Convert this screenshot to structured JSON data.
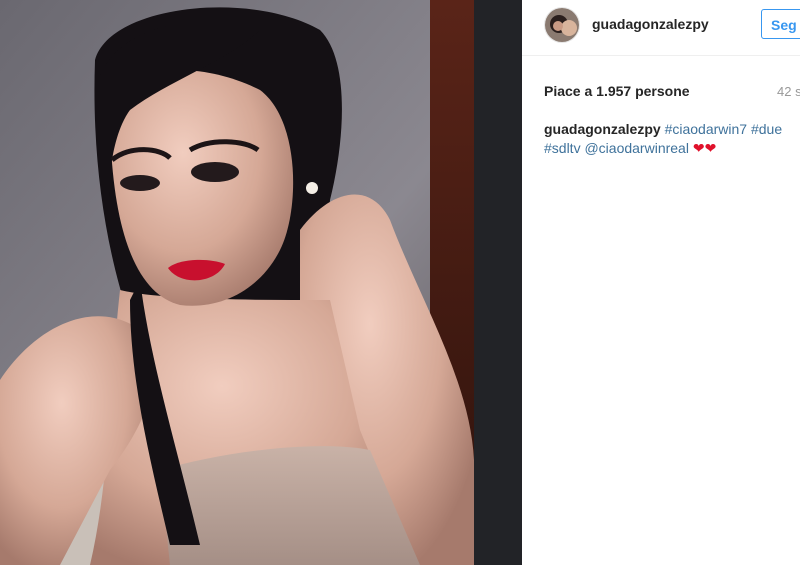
{
  "post": {
    "username": "guadagonzalezpy",
    "follow_label": "Seg",
    "likes_text": "Piace a 1.957 persone",
    "time_text": "42 s",
    "caption": {
      "username": "guadagonzalezpy",
      "tags_line1": [
        "#ciaodarwin7",
        "#due"
      ],
      "tags_line2": [
        "#sdltv",
        "@ciaodarwinreal"
      ],
      "emoji": "❤❤"
    }
  },
  "colors": {
    "link_blue": "#3897f0",
    "tag_blue": "#3f729b",
    "heart_red": "#e0112b"
  },
  "icons": [
    "avatar",
    "heart-icon"
  ]
}
